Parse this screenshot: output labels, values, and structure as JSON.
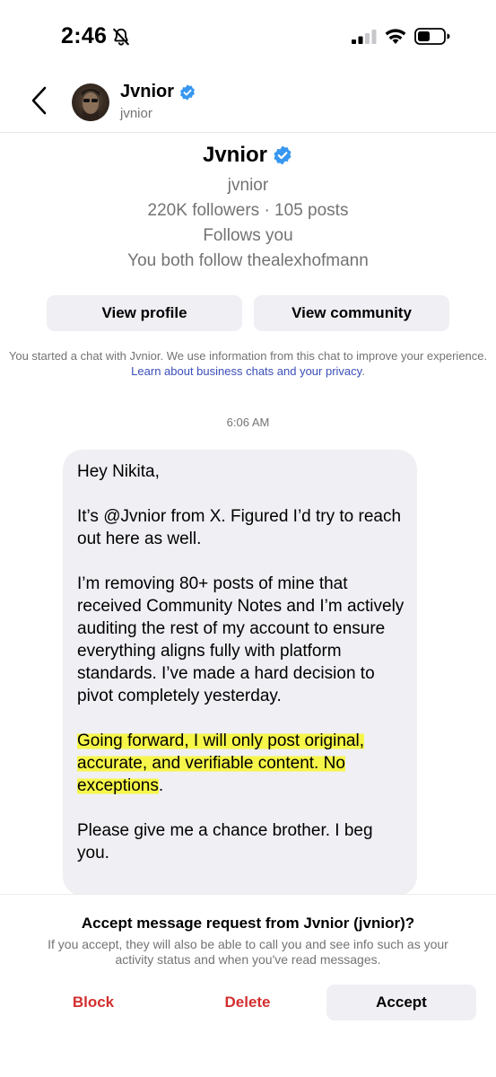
{
  "status_bar": {
    "time": "2:46",
    "icons": [
      "bell-off-icon",
      "signal-icon",
      "wifi-icon",
      "battery-icon"
    ]
  },
  "header": {
    "name": "Jvnior",
    "handle": "jvnior",
    "verified": true,
    "icons": [
      "back-chevron-icon",
      "verified-badge-icon"
    ]
  },
  "profile": {
    "name": "Jvnior",
    "handle": "jvnior",
    "stats": "220K followers · 105 posts",
    "follows_you": "Follows you",
    "mutual": "You both follow thealexhofmann",
    "view_profile_label": "View profile",
    "view_community_label": "View community"
  },
  "disclaimer": {
    "text": "You started a chat with Jvnior. We use information from this chat to improve your experience.",
    "link": "Learn about business chats and your privacy",
    "link_suffix": "."
  },
  "timestamp": "6:06 AM",
  "message": {
    "greeting": "Hey Nikita,",
    "p1": "It’s @Jvnior from X. Figured I’d try to reach out here as well.",
    "p2": "I’m removing 80+ posts of mine that received Community Notes and I’m actively auditing the rest of my account to ensure everything aligns fully with platform standards. I’ve made a hard decision to pivot completely yesterday.",
    "p3_highlighted": "Going forward, I will only post original, accurate, and verifiable content. No exceptions",
    "p3_end": ".",
    "p4": "Please give me a chance brother. I beg you.",
    "highlight_color": "#f7f63b"
  },
  "request_sheet": {
    "title": "Accept message request from Jvnior (jvnior)?",
    "description": "If you accept, they will also be able to call you and see info such as your activity status and when you've read messages.",
    "block_label": "Block",
    "delete_label": "Delete",
    "accept_label": "Accept",
    "destructive_color": "#d32f2f"
  },
  "colors": {
    "verified_blue": "#3897f0",
    "bubble_gray": "#efeff4",
    "secondary_text": "#737373",
    "link_blue": "#3b4fb8"
  }
}
